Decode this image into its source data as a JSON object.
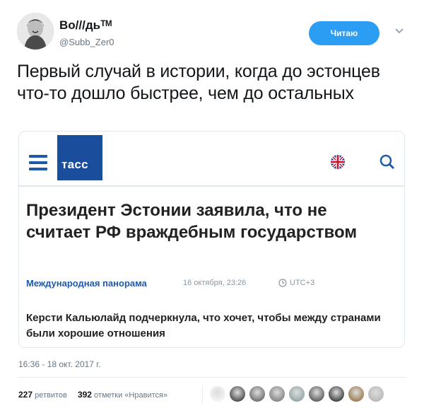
{
  "author": {
    "display_name": "Во///дьᵀᴹ",
    "handle": "@Subb_Zer0"
  },
  "follow_button": {
    "label": "Читаю"
  },
  "tweet": {
    "text": "Первый случай в истории, когда до эстонцев что-то дошло быстрее, чем до остальных",
    "timestamp": "16:36 - 18 окт. 2017 г."
  },
  "card": {
    "logo_text": "тасс",
    "title": "Президент Эстонии заявила, что не считает РФ враждебным государством",
    "category": "Международная панорама",
    "date": "16 октября, 23:26",
    "timezone": "UTC+3",
    "lead": "Керсти Кальюлайд подчеркнула, что хочет, чтобы между странами были хорошие отношения",
    "accent_color": "#1a4d9c"
  },
  "stats": {
    "retweets_count": "227",
    "retweets_label": "ретвитов",
    "likes_count": "392",
    "likes_label": "отметки «Нравится»"
  },
  "colors": {
    "follow_button": "#2b9df2",
    "text": "#14171a",
    "secondary": "#657786"
  },
  "liker_avatars": [
    "avatar-1",
    "avatar-2",
    "avatar-3",
    "avatar-4",
    "avatar-5",
    "avatar-6",
    "avatar-7",
    "avatar-8",
    "avatar-9"
  ]
}
